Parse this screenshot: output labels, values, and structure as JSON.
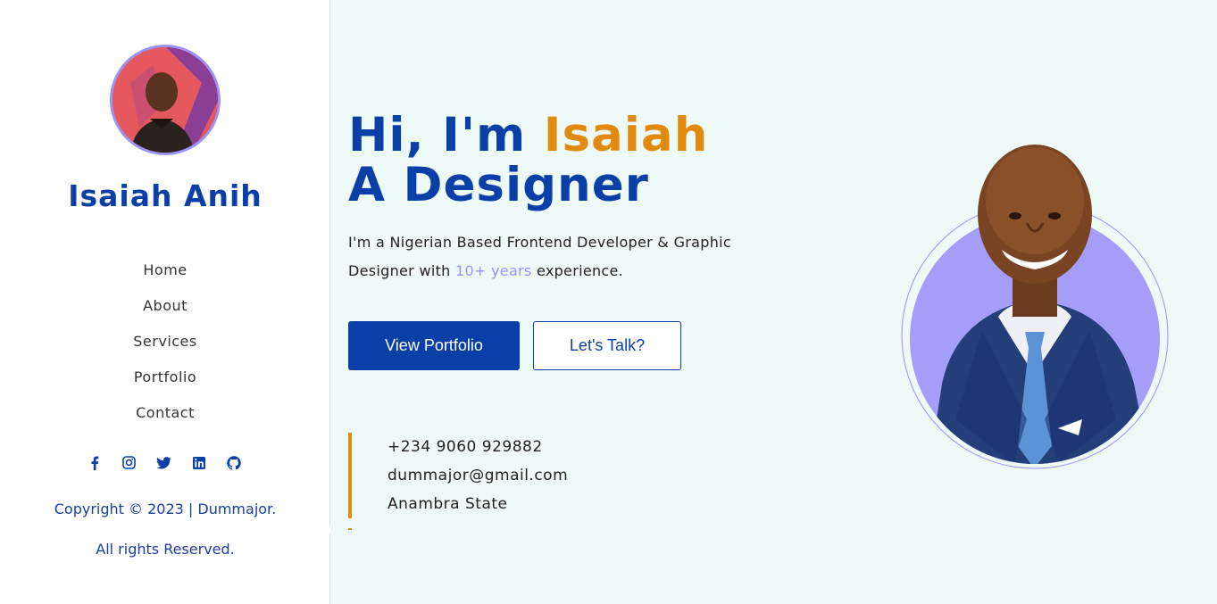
{
  "sidebar": {
    "name": "Isaiah Anih",
    "nav": [
      {
        "label": "Home"
      },
      {
        "label": "About"
      },
      {
        "label": "Services"
      },
      {
        "label": "Portfolio"
      },
      {
        "label": "Contact"
      }
    ],
    "socials": [
      "facebook-icon",
      "instagram-icon",
      "twitter-icon",
      "linkedin-icon",
      "github-icon"
    ],
    "copyright_line1": "Copyright © 2023 | Dummajor.",
    "copyright_line2": "All rights Reserved."
  },
  "hero": {
    "greeting": "Hi, I'm ",
    "name": "Isaiah",
    "role": "A Designer",
    "desc_before": "I'm a Nigerian Based Frontend Developer & Graphic Designer with ",
    "desc_highlight": "10+ years",
    "desc_after": " experience.",
    "primary_button": "View Portfolio",
    "secondary_button": "Let's Talk?"
  },
  "contact": {
    "phone": "+234 9060 929882",
    "email": "dummajor@gmail.com",
    "location": "Anambra State"
  },
  "colors": {
    "brand_blue": "#0b3fa8",
    "accent_orange": "#e08b10",
    "lavender": "#9b93f5",
    "background": "#eefaf7"
  }
}
